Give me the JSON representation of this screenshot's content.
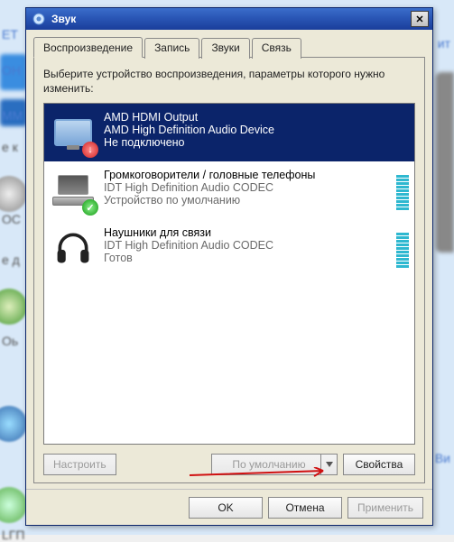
{
  "window": {
    "title": "Звук"
  },
  "tabs": [
    {
      "id": "playback",
      "label": "Воспроизведение",
      "active": true
    },
    {
      "id": "record",
      "label": "Запись",
      "active": false
    },
    {
      "id": "sounds",
      "label": "Звуки",
      "active": false
    },
    {
      "id": "comm",
      "label": "Связь",
      "active": false
    }
  ],
  "instruction": "Выберите устройство воспроизведения, параметры которого нужно изменить:",
  "devices": [
    {
      "name": "AMD HDMI Output",
      "driver": "AMD High Definition Audio Device",
      "status": "Не подключено",
      "selected": true,
      "icon": "monitor",
      "badge": "down-arrow-red",
      "meter": false
    },
    {
      "name": "Громкоговорители / головные телефоны",
      "driver": "IDT High Definition Audio CODEC",
      "status": "Устройство по умолчанию",
      "selected": false,
      "icon": "laptop",
      "badge": "check-green",
      "meter": true
    },
    {
      "name": "Наушники для связи",
      "driver": "IDT High Definition Audio CODEC",
      "status": "Готов",
      "selected": false,
      "icon": "headphones",
      "badge": null,
      "meter": true
    }
  ],
  "buttons": {
    "configure": "Настроить",
    "setdefault": "По умолчанию",
    "properties": "Свойства",
    "ok": "OK",
    "cancel": "Отмена",
    "apply": "Применить"
  },
  "bg": {
    "t1": "ET",
    "t2": "OН",
    "t3": "MМ",
    "t4": "e к",
    "t5": "OС",
    "t6": "e д",
    "t7": "Оь",
    "t8": "LГП",
    "r1": "ит",
    "r2": "Bи"
  }
}
